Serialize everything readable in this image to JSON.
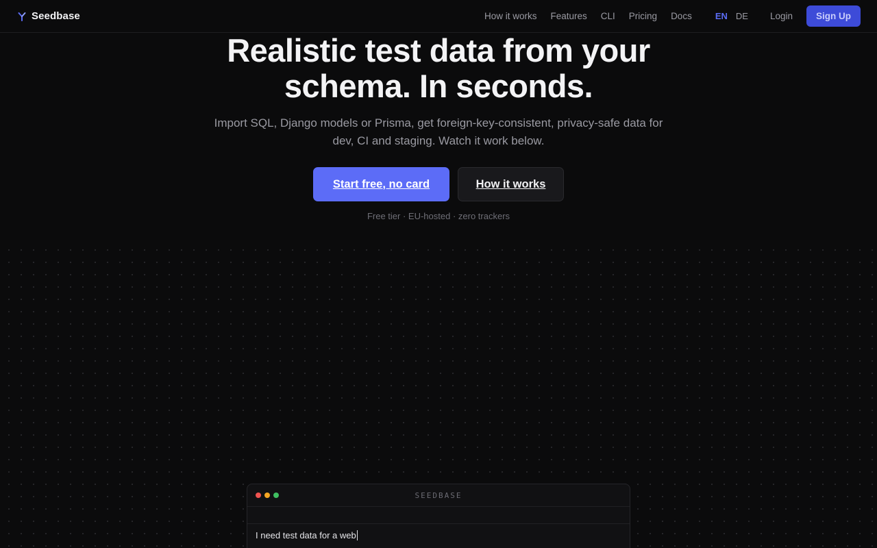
{
  "brand": {
    "name": "Seedbase",
    "logo_icon": "sprout-icon",
    "accent": "#5c6cf7"
  },
  "nav": {
    "links": [
      "How it works",
      "Features",
      "CLI",
      "Pricing",
      "Docs"
    ],
    "languages": [
      "EN",
      "DE"
    ],
    "active_language": "EN",
    "login": "Login",
    "signup": "Sign Up"
  },
  "hero": {
    "headline_line1": "Realistic test data from your",
    "headline_line2": "schema. In seconds.",
    "subtitle": "Import SQL, Django models or Prisma, get foreign-key-consistent, privacy-safe data for dev, CI and staging. Watch it work below.",
    "primary_cta": "Start free, no card",
    "secondary_cta": "How it works",
    "trust_line": "Free tier · EU-hosted · zero trackers"
  },
  "demo": {
    "window_title": "SEEDBASE",
    "window_dots": [
      "#ef5350",
      "#f5a623",
      "#3fbf61"
    ],
    "input_text": "I need test data for a web"
  }
}
